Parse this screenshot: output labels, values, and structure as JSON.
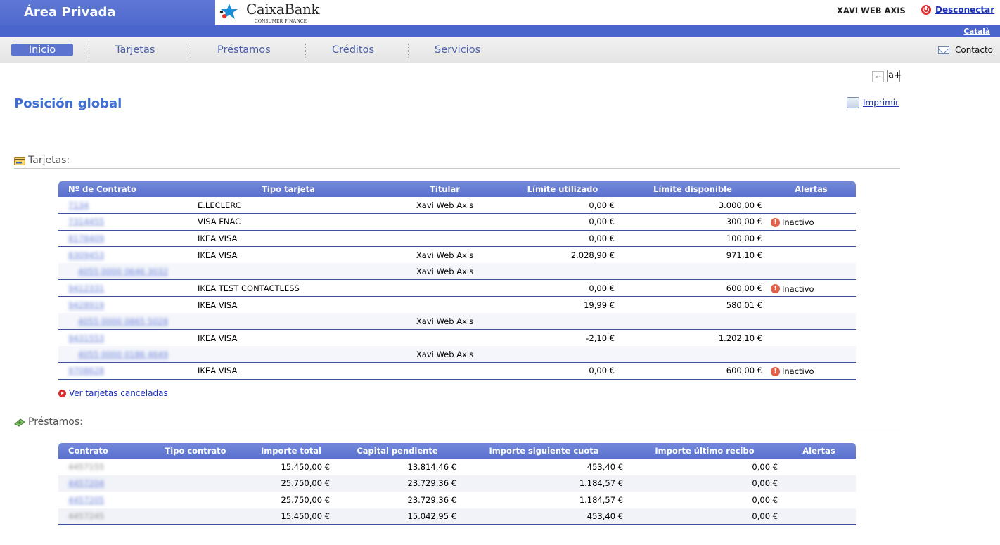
{
  "header": {
    "title": "Área Privada",
    "brand": "CaixaBank",
    "brand_sub": "CONSUMER FINANCE",
    "user_name": "XAVI WEB AXIS",
    "disconnect_label": "Desconectar",
    "language_link": "Català"
  },
  "nav": {
    "items": [
      {
        "label": "Inicio"
      },
      {
        "label": "Tarjetas"
      },
      {
        "label": "Préstamos"
      },
      {
        "label": "Créditos"
      },
      {
        "label": "Servicios"
      }
    ],
    "contact_label": "Contacto"
  },
  "font_controls": {
    "decrease": "a-",
    "increase": "a+"
  },
  "page": {
    "title": "Posición global",
    "print_label": "Imprimir"
  },
  "cards_section": {
    "title": "Tarjetas:",
    "headers": [
      "Nº de Contrato",
      "Tipo tarjeta",
      "Titular",
      "Límite utilizado",
      "Límite disponible",
      "Alertas"
    ],
    "rows": [
      {
        "contract": "7134",
        "type": "E.LECLERC",
        "holder": "Xavi Web Axis",
        "used": "0,00 €",
        "available": "3.000,00 €",
        "alert": ""
      },
      {
        "contract": "7314455",
        "type": "VISA FNAC",
        "holder": "",
        "used": "0,00 €",
        "available": "300,00 €",
        "alert": "Inactivo"
      },
      {
        "contract": "8178409",
        "type": "IKEA VISA",
        "holder": "",
        "used": "0,00 €",
        "available": "100,00 €",
        "alert": ""
      },
      {
        "contract": "8309453",
        "type": "IKEA VISA",
        "holder": "Xavi Web Axis",
        "used": "2.028,90 €",
        "available": "971,10 €",
        "alert": ""
      },
      {
        "card_number": "4055 0000 0646 3032",
        "holder": "Xavi Web Axis"
      },
      {
        "contract": "9412331",
        "type": "IKEA TEST CONTACTLESS",
        "holder": "",
        "used": "0,00 €",
        "available": "600,00 €",
        "alert": "Inactivo"
      },
      {
        "contract": "9428919",
        "type": "IKEA VISA",
        "holder": "",
        "used": "19,99 €",
        "available": "580,01 €",
        "alert": ""
      },
      {
        "card_number": "4055 0000 0865 5028",
        "holder": "Xavi Web Axis"
      },
      {
        "contract": "9431553",
        "type": "IKEA VISA",
        "holder": "",
        "used": "-2,10 €",
        "available": "1.202,10 €",
        "alert": ""
      },
      {
        "card_number": "4055 0000 0186 4649",
        "holder": "Xavi Web Axis"
      },
      {
        "contract": "9708628",
        "type": "IKEA VISA",
        "holder": "",
        "used": "0,00 €",
        "available": "600,00 €",
        "alert": "Inactivo"
      }
    ],
    "cancelled_link": "Ver tarjetas canceladas"
  },
  "loans_section": {
    "title": "Préstamos:",
    "headers": [
      "Contrato",
      "Tipo contrato",
      "Importe total",
      "Capital pendiente",
      "Importe siguiente cuota",
      "Importe último recibo",
      "Alertas"
    ],
    "rows": [
      {
        "contract": "4457155",
        "type": "",
        "total": "15.450,00 €",
        "pending": "13.814,46 €",
        "next": "453,40 €",
        "last": "0,00 €",
        "alert": ""
      },
      {
        "contract": "4457204",
        "type": "",
        "total": "25.750,00 €",
        "pending": "23.729,36 €",
        "next": "1.184,57 €",
        "last": "0,00 €",
        "alert": ""
      },
      {
        "contract": "4457205",
        "type": "",
        "total": "25.750,00 €",
        "pending": "23.729,36 €",
        "next": "1.184,57 €",
        "last": "0,00 €",
        "alert": ""
      },
      {
        "contract": "4457245",
        "type": "",
        "total": "15.450,00 €",
        "pending": "15.042,95 €",
        "next": "453,40 €",
        "last": "0,00 €",
        "alert": ""
      }
    ]
  }
}
